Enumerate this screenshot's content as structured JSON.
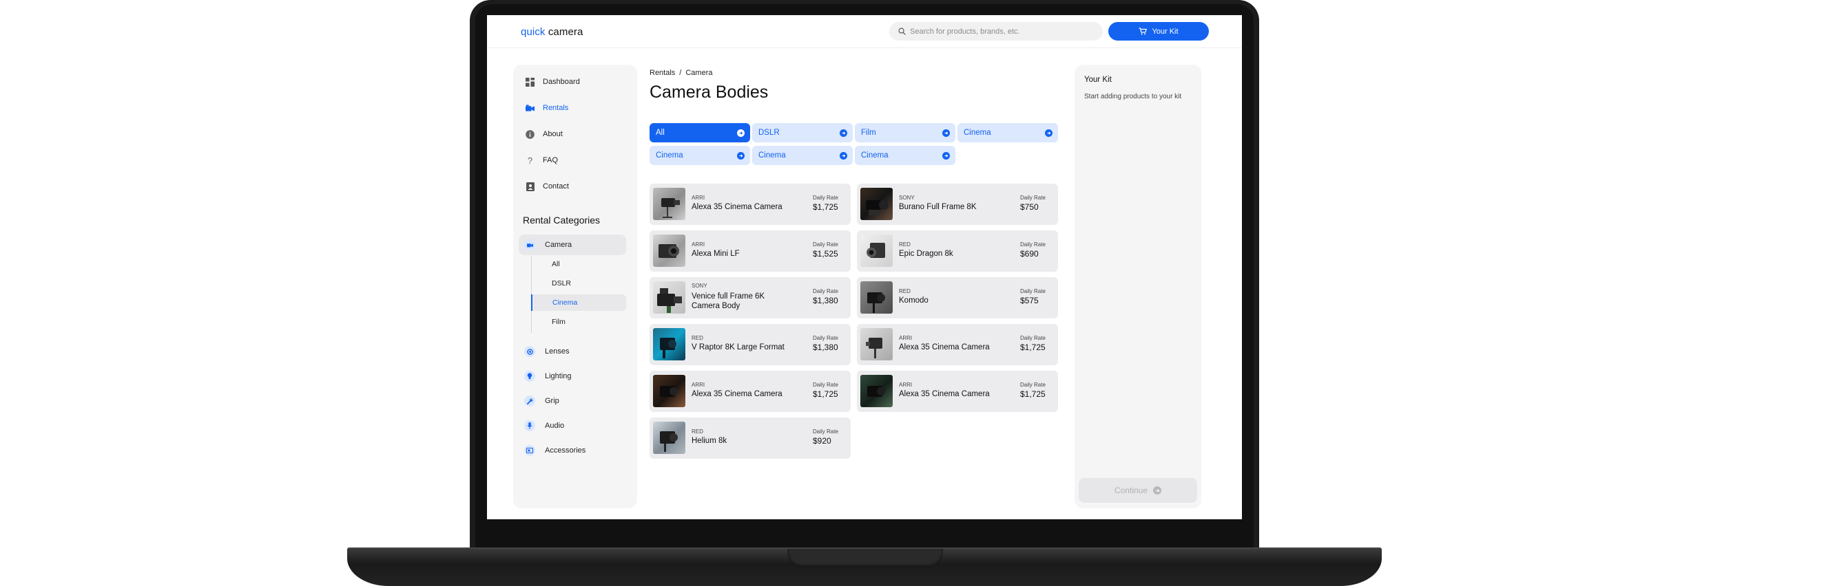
{
  "header": {
    "logo_part1": "quick",
    "logo_part2": "camera",
    "search_placeholder": "Search for products, brands, etc.",
    "kit_button_label": "Your Kit"
  },
  "sidebar": {
    "nav": [
      {
        "label": "Dashboard",
        "icon": "dashboard-icon"
      },
      {
        "label": "Rentals",
        "icon": "camera-icon",
        "active": true
      },
      {
        "label": "About",
        "icon": "info-icon"
      },
      {
        "label": "FAQ",
        "icon": "question-icon"
      },
      {
        "label": "Contact",
        "icon": "contact-icon"
      }
    ],
    "categories_title": "Rental Categories",
    "categories": [
      {
        "label": "Camera",
        "icon": "camera-icon",
        "open": true
      },
      {
        "label": "Lenses",
        "icon": "lens-icon"
      },
      {
        "label": "Lighting",
        "icon": "bulb-icon"
      },
      {
        "label": "Grip",
        "icon": "wrench-icon"
      },
      {
        "label": "Audio",
        "icon": "mic-icon"
      },
      {
        "label": "Accessories",
        "icon": "accessories-icon"
      }
    ],
    "camera_subcategories": [
      {
        "label": "All"
      },
      {
        "label": "DSLR"
      },
      {
        "label": "Cinema",
        "active": true
      },
      {
        "label": "Film"
      }
    ]
  },
  "main": {
    "breadcrumb": [
      "Rentals",
      "Camera"
    ],
    "breadcrumb_separator": "/",
    "title": "Camera Bodies",
    "filters": [
      {
        "label": "All",
        "active": true
      },
      {
        "label": "DSLR"
      },
      {
        "label": "Film"
      },
      {
        "label": "Cinema"
      },
      {
        "label": "Cinema"
      },
      {
        "label": "Cinema"
      },
      {
        "label": "Cinema"
      }
    ],
    "rate_label": "Daily Rate",
    "products": [
      {
        "brand": "ARRI",
        "name": "Alexa 35 Cinema Camera",
        "rate": "$1,725"
      },
      {
        "brand": "SONY",
        "name": "Burano Full Frame 8K",
        "rate": "$750"
      },
      {
        "brand": "ARRI",
        "name": "Alexa Mini LF",
        "rate": "$1,525"
      },
      {
        "brand": "RED",
        "name": "Epic Dragon 8k",
        "rate": "$690"
      },
      {
        "brand": "SONY",
        "name": "Venice full Frame 6K Camera Body",
        "rate": "$1,380"
      },
      {
        "brand": "RED",
        "name": "Komodo",
        "rate": "$575"
      },
      {
        "brand": "RED",
        "name": "V Raptor 8K Large Format",
        "rate": "$1,380"
      },
      {
        "brand": "ARRI",
        "name": "Alexa 35 Cinema Camera",
        "rate": "$1,725"
      },
      {
        "brand": "ARRI",
        "name": "Alexa 35 Cinema Camera",
        "rate": "$1,725"
      },
      {
        "brand": "ARRI",
        "name": "Alexa 35 Cinema Camera",
        "rate": "$1,725"
      },
      {
        "brand": "RED",
        "name": "Helium 8k",
        "rate": "$920"
      }
    ]
  },
  "kit": {
    "title": "Your Kit",
    "empty_message": "Start adding products to your kit",
    "continue_label": "Continue"
  },
  "colors": {
    "accent": "#1463f0",
    "chip_bg": "#dbe8fd",
    "panel_bg": "#f5f5f6",
    "card_bg": "#ececee"
  }
}
